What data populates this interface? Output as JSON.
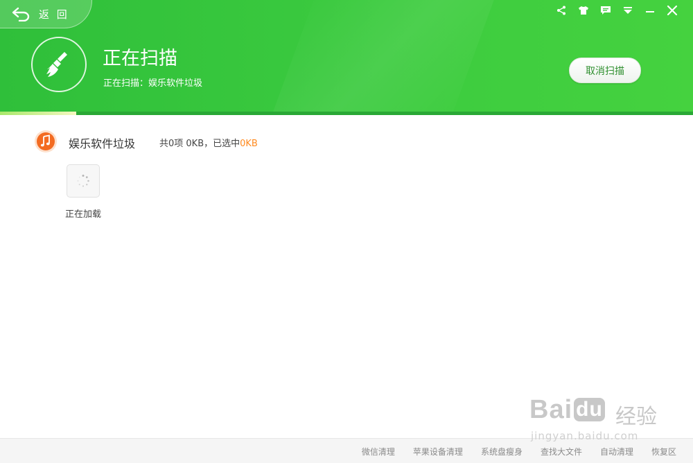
{
  "header": {
    "back_label": "返 回",
    "title": "正在扫描",
    "subtitle": "正在扫描：娱乐软件垃圾",
    "cancel_label": "取消扫描",
    "progress_fraction": 0.11,
    "colors": {
      "green": "#3ccb3f",
      "accent_orange": "#ff8a1f"
    }
  },
  "window_controls": [
    {
      "name": "share-icon"
    },
    {
      "name": "skin-icon"
    },
    {
      "name": "feedback-icon"
    },
    {
      "name": "menu-icon"
    },
    {
      "name": "minimize-icon"
    },
    {
      "name": "close-icon"
    }
  ],
  "category": {
    "icon": "music-icon",
    "name": "娱乐软件垃圾",
    "stats_prefix": "共0项 0KB，已选中",
    "stats_selected": "0KB"
  },
  "loading": {
    "icon": "spinner-icon",
    "label": "正在加载"
  },
  "footer": {
    "links": [
      "微信清理",
      "苹果设备清理",
      "系统盘瘦身",
      "查找大文件",
      "自动清理",
      "恢复区"
    ]
  },
  "watermark": {
    "logo_a": "Bai",
    "logo_b": "du",
    "logo_cn": "经验",
    "url": "jingyan.baidu.com"
  }
}
